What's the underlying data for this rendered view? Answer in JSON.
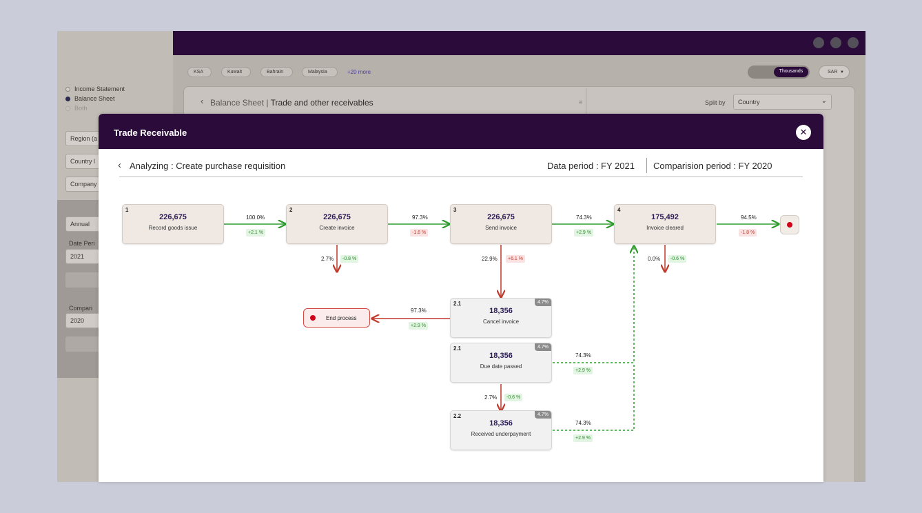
{
  "statement_options": [
    "Income Statement",
    "Balance Sheet",
    "Both"
  ],
  "sidebar": {
    "region": "Region (a",
    "country": "Country l",
    "company": "Company",
    "frequency": "Annual",
    "date_period_label": "Date Peri",
    "date_period_value": "2021",
    "comparison_label": "Compari",
    "comparison_value": "2020"
  },
  "filters": {
    "chips": [
      "KSA",
      "Kuwait",
      "Bahrain",
      "Malaysia"
    ],
    "more": "+20 more",
    "toggle_selected": "Thousands",
    "currency": "SAR"
  },
  "background_panel": {
    "title_light": "Balance Sheet",
    "title_bold": "Trade and other receivables",
    "split_label": "Split by",
    "split_value": "Country"
  },
  "modal": {
    "title": "Trade Receivable",
    "analyzing": "Analyzing : Create purchase requisition",
    "data_period": "Data period : FY 2021",
    "comparison_period": "Comparision period : FY 2020"
  },
  "flow": {
    "nodes": [
      {
        "id": "1",
        "value": "226,675",
        "label": "Record goods issue"
      },
      {
        "id": "2",
        "value": "226,675",
        "label": "Create invoice"
      },
      {
        "id": "3",
        "value": "226,675",
        "label": "Send invoice"
      },
      {
        "id": "4",
        "value": "175,492",
        "label": "Invoice cleared"
      },
      {
        "id": "2.1",
        "value": "18,356",
        "label": "Cancel invoice",
        "pct": "4.7%"
      },
      {
        "id": "2.1",
        "value": "18,356",
        "label": "Due date passed",
        "pct": "4.7%"
      },
      {
        "id": "2.2",
        "value": "18,356",
        "label": "Received underpayment",
        "pct": "4.7%"
      }
    ],
    "edges": [
      {
        "pct": "100.0%",
        "delta": "+2.1 %"
      },
      {
        "pct": "97.3%",
        "delta": "-1.6 %"
      },
      {
        "pct": "74.3%",
        "delta": "+2.9 %"
      },
      {
        "pct": "94.5%",
        "delta": "-1.8 %"
      },
      {
        "pct": "2.7%",
        "delta": "-0.8 %"
      },
      {
        "pct": "22.9%",
        "delta": "+6.1 %"
      },
      {
        "pct": "0.0%",
        "delta": "-0.6 %"
      },
      {
        "pct": "97.3%",
        "delta": "+2.9 %"
      },
      {
        "pct": "74.3%",
        "delta": "+2.9 %"
      },
      {
        "pct": "2.7%",
        "delta": "-0.6 %"
      },
      {
        "pct": "74.3%",
        "delta": "+2.9 %"
      }
    ],
    "end_process": "End process"
  },
  "colors": {
    "brand": "#2a0b3a",
    "green": "#2e9a2e",
    "red": "#c0392b",
    "node_bg": "#f0e9e3"
  }
}
